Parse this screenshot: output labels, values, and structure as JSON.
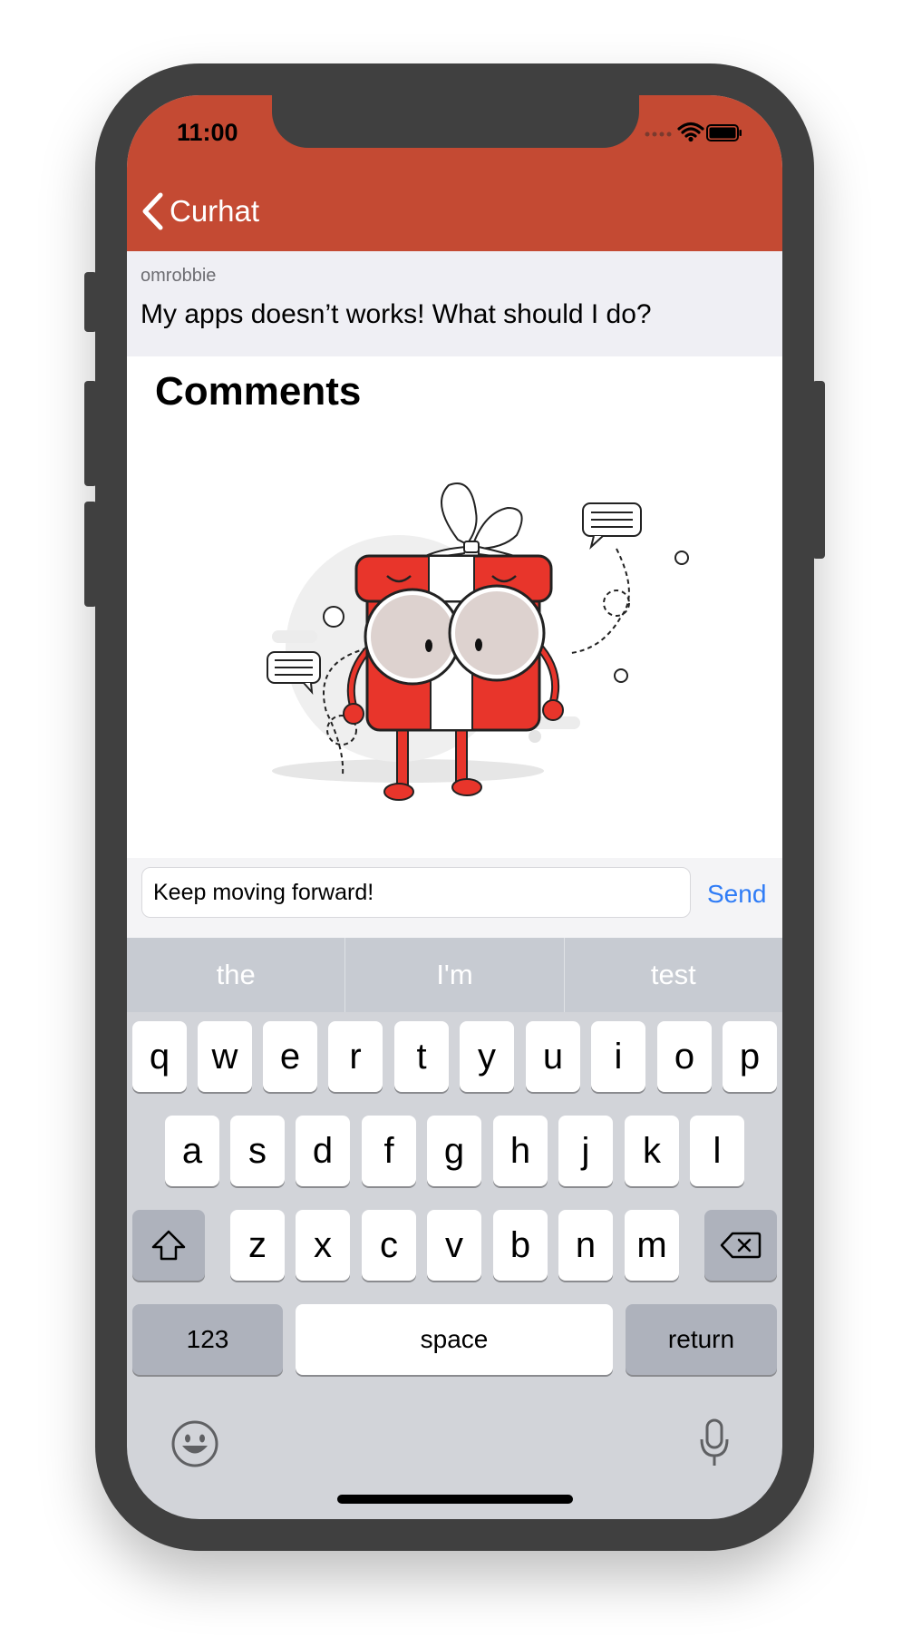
{
  "status_bar": {
    "time": "11:00"
  },
  "nav": {
    "back_label": "Curhat"
  },
  "post": {
    "username": "omrobbie",
    "text": "My apps doesn’t works! What should I do?"
  },
  "comments": {
    "title": "Comments"
  },
  "composer": {
    "value": "Keep moving forward!",
    "send_label": "Send"
  },
  "keyboard": {
    "suggestions": [
      "the",
      "I'm",
      "test"
    ],
    "row1": [
      "q",
      "w",
      "e",
      "r",
      "t",
      "y",
      "u",
      "i",
      "o",
      "p"
    ],
    "row2": [
      "a",
      "s",
      "d",
      "f",
      "g",
      "h",
      "j",
      "k",
      "l"
    ],
    "row3": [
      "z",
      "x",
      "c",
      "v",
      "b",
      "n",
      "m"
    ],
    "numbers_label": "123",
    "space_label": "space",
    "return_label": "return"
  },
  "colors": {
    "accent": "#c44a33",
    "link": "#2f7cf6",
    "gift_red": "#e8352b"
  },
  "icons": [
    "chevron-left-icon",
    "wifi-icon",
    "battery-icon",
    "signal-icon",
    "shift-icon",
    "backspace-icon",
    "emoji-icon",
    "microphone-icon"
  ]
}
